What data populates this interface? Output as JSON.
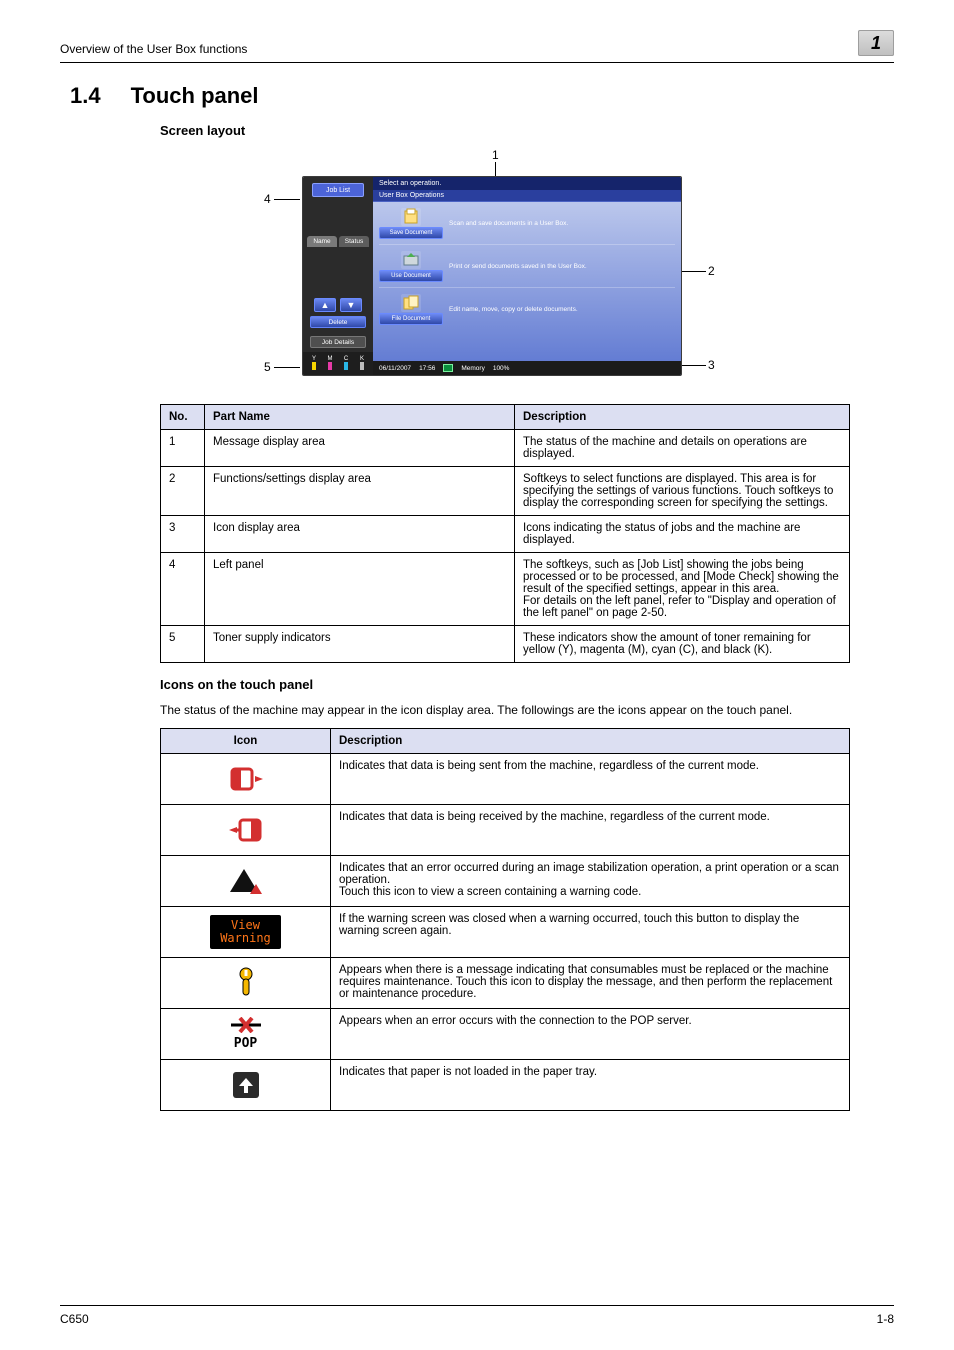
{
  "header": {
    "title": "Overview of the User Box functions",
    "corner": "1"
  },
  "section": {
    "num": "1.4",
    "title": "Touch panel",
    "sub1": "Screen layout",
    "sub2": "Icons on the touch panel",
    "para": "The status of the machine may appear in the icon display area. The followings are the icons appear on the touch panel."
  },
  "callouts": {
    "l1": "1",
    "l2": "2",
    "l3": "3",
    "l4": "4",
    "l5": "5"
  },
  "panel": {
    "jobList": "Job List",
    "tabs": {
      "name": "Name",
      "status": "Status"
    },
    "delete": "Delete",
    "jobDetails": "Job Details",
    "msg": "Select an operation.",
    "userBoxOps": "User Box Operations",
    "ops": [
      {
        "label": "Save Document",
        "text": "Scan and save documents in a User Box."
      },
      {
        "label": "Use Document",
        "text": "Print or send documents saved in the User Box."
      },
      {
        "label": "File Document",
        "text": "Edit name, move, copy or delete documents."
      }
    ],
    "status": {
      "date": "06/11/2007",
      "time": "17:56",
      "memoryLabel": "Memory",
      "memory": "100%"
    },
    "toner": {
      "y": "Y",
      "m": "M",
      "c": "C",
      "k": "K"
    }
  },
  "partsTable": {
    "headers": {
      "no": "No.",
      "part": "Part Name",
      "desc": "Description"
    },
    "rows": [
      {
        "no": "1",
        "part": "Message display area",
        "desc": "The status of the machine and details on operations are displayed."
      },
      {
        "no": "2",
        "part": "Functions/settings display area",
        "desc": "Softkeys to select functions are displayed. This area is for specifying the settings of various functions. Touch softkeys to display the corresponding screen for specifying the settings."
      },
      {
        "no": "3",
        "part": "Icon display area",
        "desc": "Icons indicating the status of jobs and the machine are displayed."
      },
      {
        "no": "4",
        "part": "Left panel",
        "desc": "The softkeys, such as [Job List] showing the jobs being processed or to be processed, and [Mode Check] showing the result of the specified settings, appear in this area.\nFor details on the left panel, refer to \"Display and operation of the left panel\" on page 2-50."
      },
      {
        "no": "5",
        "part": "Toner supply indicators",
        "desc": "These indicators show the amount of toner remaining for yellow (Y), magenta (M), cyan (C), and black (K)."
      }
    ]
  },
  "iconsTable": {
    "headers": {
      "icon": "Icon",
      "desc": "Description"
    },
    "rows": [
      {
        "iconName": "data-send-icon",
        "desc": "Indicates that data is being sent from the machine, regardless of the current mode."
      },
      {
        "iconName": "data-receive-icon",
        "desc": "Indicates that data is being received by the machine, regardless of the current mode."
      },
      {
        "iconName": "warning-triangle-icon",
        "desc": "Indicates that an error occurred during an image stabilization operation, a print operation or a scan operation.\nTouch this icon to view a screen containing a warning code."
      },
      {
        "iconName": "view-warning-button",
        "viewWarn1": "View",
        "viewWarn2": "Warning",
        "desc": "If the warning screen was closed when a warning occurred, touch this button to display the warning screen again."
      },
      {
        "iconName": "maintenance-icon",
        "desc": "Appears when there is a message indicating that consumables must be replaced or the machine requires maintenance. Touch this icon to display the message, and then perform the replacement or maintenance procedure."
      },
      {
        "iconName": "pop-error-icon",
        "popLabel": "POP",
        "desc": "Appears when an error occurs with the connection to the POP server."
      },
      {
        "iconName": "no-paper-icon",
        "desc": "Indicates that paper is not loaded in the paper tray."
      }
    ]
  },
  "footer": {
    "left": "C650",
    "right": "1-8"
  }
}
